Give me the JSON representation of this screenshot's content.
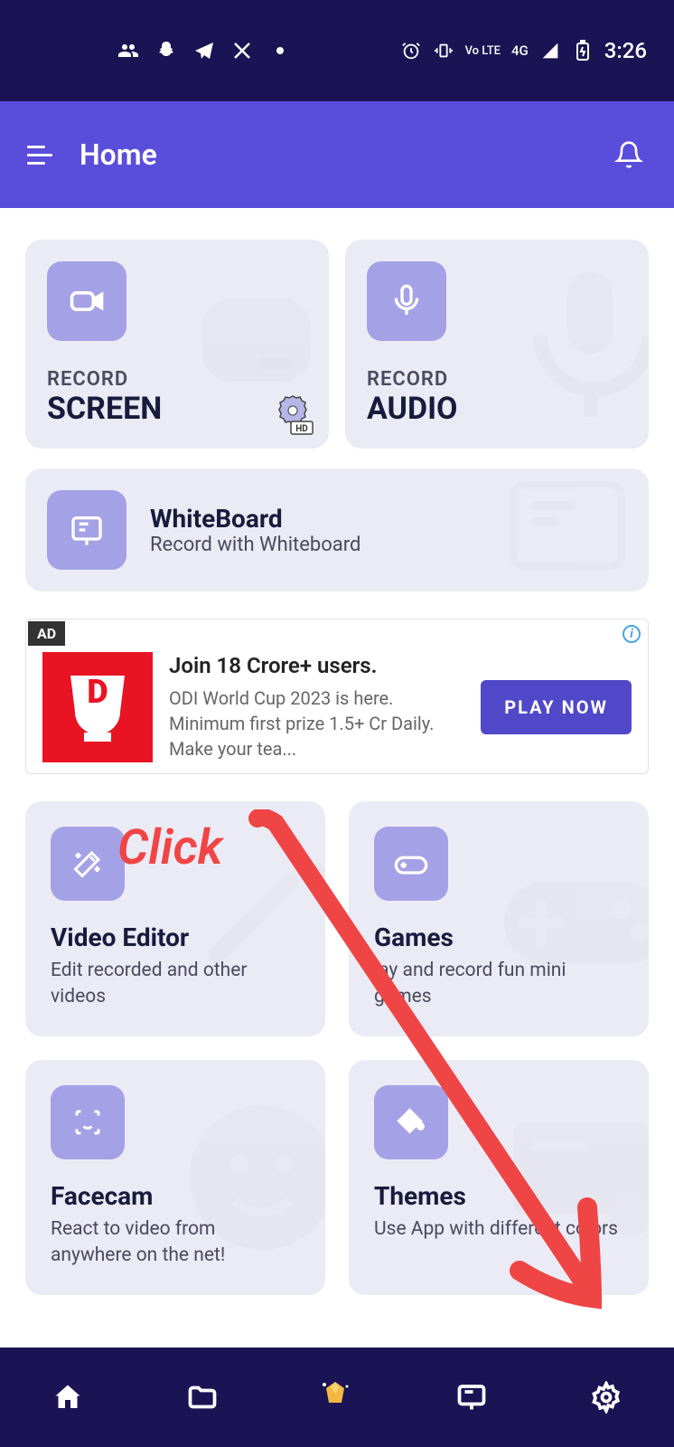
{
  "status_bar": {
    "time": "3:26",
    "network_label": "4G",
    "lte_label": "Vo LTE"
  },
  "header": {
    "title": "Home"
  },
  "cards": {
    "record_screen": {
      "label_small": "RECORD",
      "label_big": "SCREEN"
    },
    "record_audio": {
      "label_small": "RECORD",
      "label_big": "AUDIO"
    },
    "whiteboard": {
      "title": "WhiteBoard",
      "subtitle": "Record with Whiteboard"
    }
  },
  "ad": {
    "tag": "AD",
    "title": "Join 18 Crore+ users.",
    "description": "ODI World Cup 2023 is here. Minimum first prize 1.5+ Cr Daily. Make your tea...",
    "cta": "PLAY NOW",
    "logo_letter": "D"
  },
  "features": {
    "video_editor": {
      "title": "Video Editor",
      "description": "Edit recorded and other videos"
    },
    "games": {
      "title": "Games",
      "description": "lay and record fun mini games"
    },
    "facecam": {
      "title": "Facecam",
      "description": "React to video from anywhere on the net!"
    },
    "themes": {
      "title": "Themes",
      "description": "Use App with different colors"
    }
  },
  "annotation": {
    "click_text": "Click"
  }
}
